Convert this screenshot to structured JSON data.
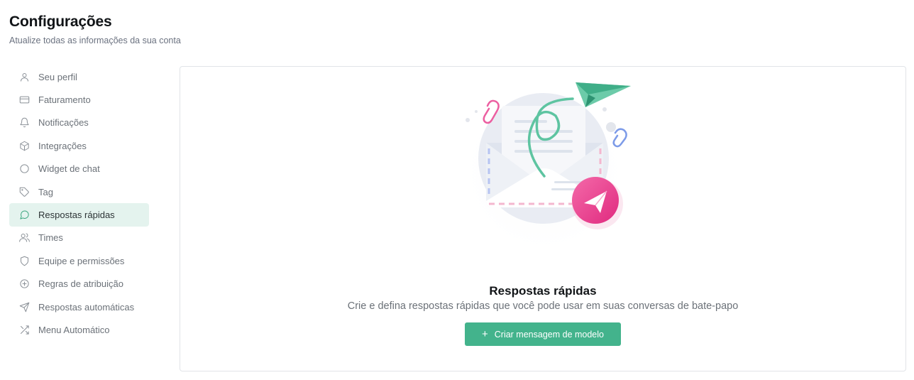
{
  "header": {
    "title": "Configurações",
    "subtitle": "Atualize todas as informações da sua conta"
  },
  "sidebar": {
    "items": [
      {
        "label": "Seu perfil",
        "icon": "user-icon"
      },
      {
        "label": "Faturamento",
        "icon": "credit-card-icon"
      },
      {
        "label": "Notificações",
        "icon": "bell-icon"
      },
      {
        "label": "Integrações",
        "icon": "cube-icon"
      },
      {
        "label": "Widget de chat",
        "icon": "circle-icon"
      },
      {
        "label": "Tag",
        "icon": "tag-icon"
      },
      {
        "label": "Respostas rápidas",
        "icon": "message-circle-icon",
        "active": true
      },
      {
        "label": "Times",
        "icon": "users-icon"
      },
      {
        "label": "Equipe e permissões",
        "icon": "shield-icon"
      },
      {
        "label": "Regras de atribuição",
        "icon": "plus-circle-icon"
      },
      {
        "label": "Respostas automáticas",
        "icon": "send-icon"
      },
      {
        "label": "Menu Automático",
        "icon": "shuffle-icon"
      }
    ]
  },
  "empty_state": {
    "title": "Respostas rápidas",
    "description": "Crie e defina respostas rápidas que você pode usar em suas conversas de bate-papo",
    "button_label": "Criar mensagem de modelo",
    "button_icon": "plus-icon"
  },
  "colors": {
    "accent": "#43b38c",
    "active_bg": "#e4f3ee",
    "illustration_pink": "#ec3d8f"
  }
}
